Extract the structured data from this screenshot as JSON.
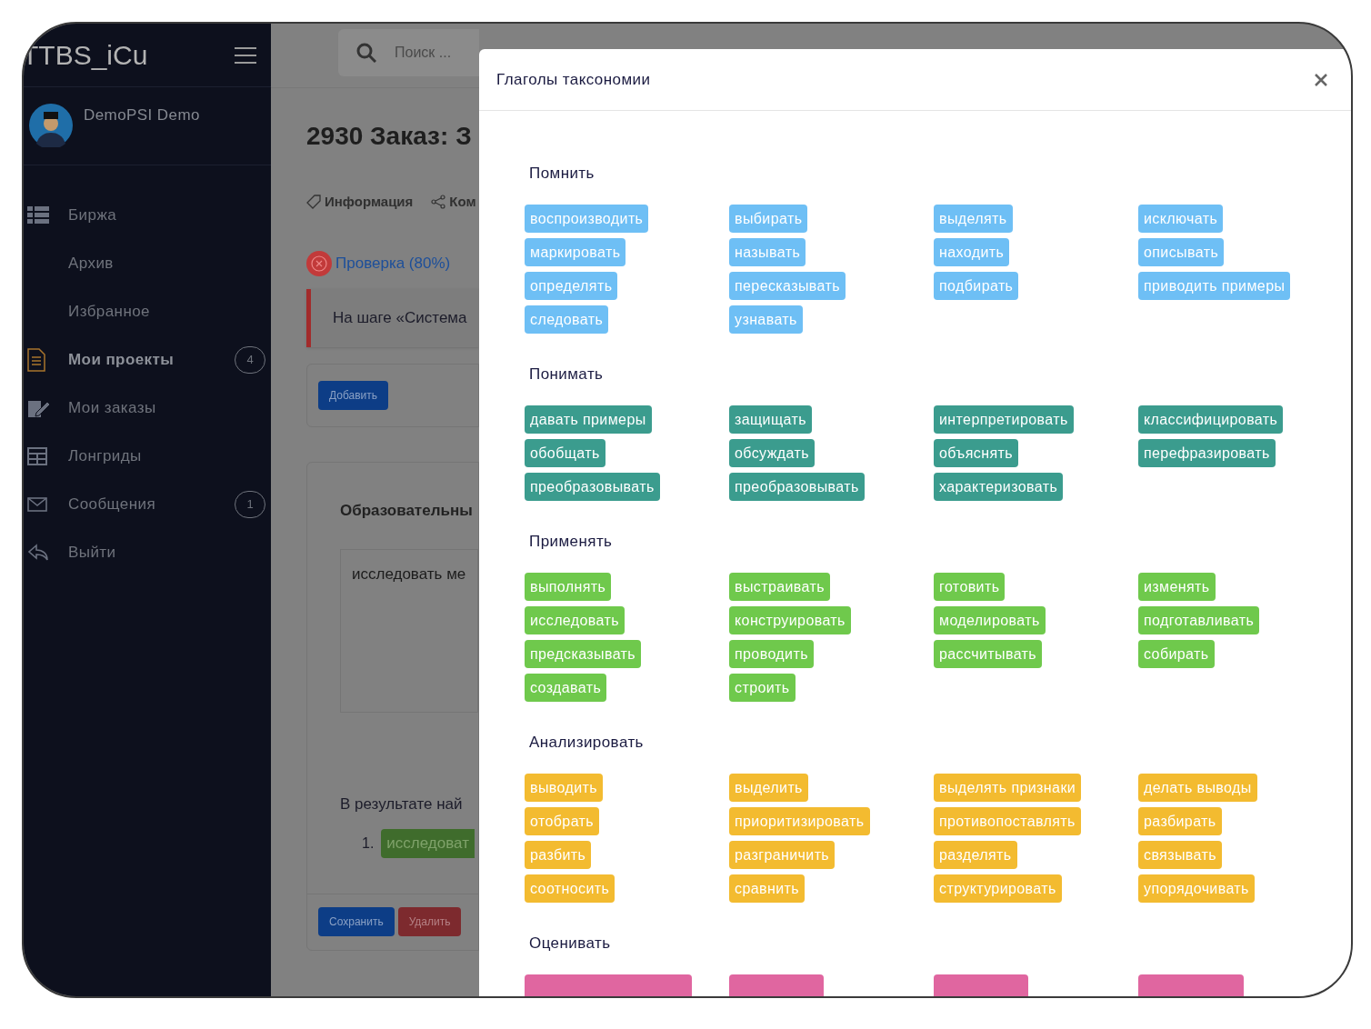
{
  "sidebar": {
    "logo": "TTBS_iCu",
    "user": "DemoPSI Demo",
    "items": [
      {
        "label": "Биржа",
        "selected": false
      },
      {
        "label": "Архив",
        "selected": false
      },
      {
        "label": "Избранное",
        "selected": false
      },
      {
        "label": "Мои проекты",
        "selected": true,
        "badge": "4"
      },
      {
        "label": "Мои заказы",
        "selected": false
      },
      {
        "label": "Лонгриды",
        "selected": false
      },
      {
        "label": "Сообщения",
        "selected": false,
        "badge": "1"
      },
      {
        "label": "Выйти",
        "selected": false
      }
    ]
  },
  "search": {
    "placeholder": "Поиск ..."
  },
  "page": {
    "title": "2930 Заказ: З",
    "tabs": [
      "Информация",
      "Ком"
    ],
    "status": "Проверка (80%)",
    "alert": "На шаге «Система",
    "add_button": "Добавить",
    "card": {
      "title": "Образовательны",
      "text": "исследовать ме",
      "result": "В результате най",
      "list_number": "1.",
      "list_chip": "исследоват",
      "save": "Сохранить",
      "delete": "Удалить"
    }
  },
  "modal": {
    "title": "Глаголы таксономии",
    "sections": [
      {
        "title": "Помнить",
        "color": "#6ebff5",
        "verbs": [
          "воспроизводить",
          "выбирать",
          "выделять",
          "исключать",
          "маркировать",
          "называть",
          "находить",
          "описывать",
          "определять",
          "пересказывать",
          "подбирать",
          "приводить примеры",
          "следовать",
          "узнавать"
        ]
      },
      {
        "title": "Понимать",
        "color": "#3b9c8e",
        "verbs": [
          "давать примеры",
          "защищать",
          "интерпретировать",
          "классифицировать",
          "обобщать",
          "обсуждать",
          "объяснять",
          "перефразировать",
          "преобразовывать",
          "преобразовывать",
          "характеризовать"
        ]
      },
      {
        "title": "Применять",
        "color": "#6fc94c",
        "verbs": [
          "выполнять",
          "выстраивать",
          "готовить",
          "изменять",
          "исследовать",
          "конструировать",
          "моделировать",
          "подготавливать",
          "предсказывать",
          "проводить",
          "рассчитывать",
          "собирать",
          "создавать",
          "строить"
        ]
      },
      {
        "title": "Анализировать",
        "color": "#f3bb30",
        "verbs": [
          "выводить",
          "выделить",
          "выделять признаки",
          "делать выводы",
          "отобрать",
          "приоритизировать",
          "противопоставлять",
          "разбирать",
          "разбить",
          "разграничить",
          "разделять",
          "связывать",
          "соотносить",
          "сравнить",
          "структурировать",
          "упорядочивать"
        ]
      },
      {
        "title": "Оценивать",
        "color": "#e066a0",
        "cut_chips": [
          {
            "kind": "wide"
          },
          {
            "kind": "narrow"
          },
          {
            "kind": "narrow"
          },
          {
            "kind": "mid"
          }
        ]
      }
    ]
  }
}
